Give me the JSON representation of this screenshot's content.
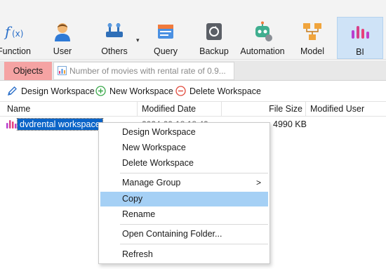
{
  "ribbon": {
    "items": [
      {
        "label": "Function",
        "icon": "function-icon"
      },
      {
        "label": "User",
        "icon": "user-icon"
      },
      {
        "label": "Others",
        "icon": "tools-icon"
      },
      {
        "label": "Query",
        "icon": "query-icon"
      },
      {
        "label": "Backup",
        "icon": "backup-icon"
      },
      {
        "label": "Automation",
        "icon": "robot-icon"
      },
      {
        "label": "Model",
        "icon": "model-icon"
      },
      {
        "label": "BI",
        "icon": "bi-icon"
      }
    ],
    "active": "BI"
  },
  "tabs": {
    "objects_label": "Objects",
    "doc_label": "Number of movies with rental rate of 0.9..."
  },
  "toolbar": {
    "design_label": "Design Workspace",
    "new_label": "New Workspace",
    "delete_label": "Delete Workspace"
  },
  "table": {
    "columns": [
      "Name",
      "Modified Date",
      "File Size",
      "Modified User"
    ],
    "rows": [
      {
        "name": "dvdrental workspace",
        "date": "2024-09-18 18:49",
        "size": "4990 KB",
        "user": ""
      }
    ]
  },
  "context_menu": {
    "items": [
      {
        "label": "Design Workspace"
      },
      {
        "label": "New Workspace"
      },
      {
        "label": "Delete Workspace"
      },
      {
        "label": "Manage Group",
        "submenu_arrow": ">"
      },
      {
        "label": "Copy"
      },
      {
        "label": "Rename"
      },
      {
        "label": "Open Containing Folder..."
      },
      {
        "label": "Refresh"
      }
    ],
    "highlighted": "Copy"
  },
  "colors": {
    "selection": "#0a64c8",
    "menu_highlight": "#a5d0f5",
    "objects_tab": "#f5a3a3",
    "ribbon_active": "#cfe3f7"
  }
}
